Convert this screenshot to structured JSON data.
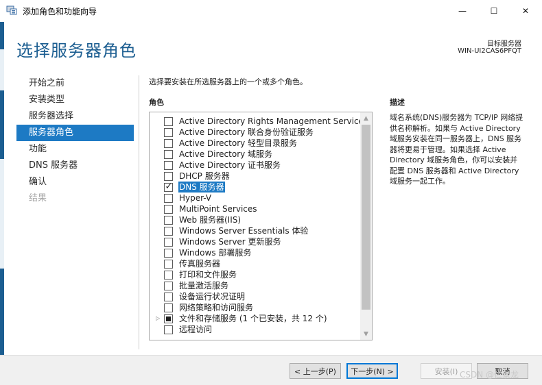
{
  "window": {
    "title": "添加角色和功能向导",
    "minimize_symbol": "—",
    "maximize_symbol": "☐",
    "close_symbol": "✕"
  },
  "header": {
    "page_title": "选择服务器角色",
    "target_label": "目标服务器",
    "target_name": "WIN-UI2CAS6PFQT"
  },
  "nav": {
    "items": [
      {
        "label": "开始之前",
        "state": "normal"
      },
      {
        "label": "安装类型",
        "state": "normal"
      },
      {
        "label": "服务器选择",
        "state": "normal"
      },
      {
        "label": "服务器角色",
        "state": "active"
      },
      {
        "label": "功能",
        "state": "normal"
      },
      {
        "label": "DNS 服务器",
        "state": "normal"
      },
      {
        "label": "确认",
        "state": "normal"
      },
      {
        "label": "结果",
        "state": "disabled"
      }
    ]
  },
  "main": {
    "instruction": "选择要安装在所选服务器上的一个或多个角色。",
    "roles_heading": "角色",
    "roles": [
      {
        "label": "Active Directory Rights Management Services",
        "state": "unchecked"
      },
      {
        "label": "Active Directory 联合身份验证服务",
        "state": "unchecked"
      },
      {
        "label": "Active Directory 轻型目录服务",
        "state": "unchecked"
      },
      {
        "label": "Active Directory 域服务",
        "state": "unchecked"
      },
      {
        "label": "Active Directory 证书服务",
        "state": "unchecked"
      },
      {
        "label": "DHCP 服务器",
        "state": "unchecked"
      },
      {
        "label": "DNS 服务器",
        "state": "checked",
        "selected": true
      },
      {
        "label": "Hyper-V",
        "state": "unchecked"
      },
      {
        "label": "MultiPoint Services",
        "state": "unchecked"
      },
      {
        "label": "Web 服务器(IIS)",
        "state": "unchecked"
      },
      {
        "label": "Windows Server Essentials 体验",
        "state": "unchecked"
      },
      {
        "label": "Windows Server 更新服务",
        "state": "unchecked"
      },
      {
        "label": "Windows 部署服务",
        "state": "unchecked"
      },
      {
        "label": "传真服务器",
        "state": "unchecked"
      },
      {
        "label": "打印和文件服务",
        "state": "unchecked"
      },
      {
        "label": "批量激活服务",
        "state": "unchecked"
      },
      {
        "label": "设备运行状况证明",
        "state": "unchecked"
      },
      {
        "label": "网络策略和访问服务",
        "state": "unchecked"
      },
      {
        "label": "文件和存储服务 (1 个已安装，共 12 个)",
        "state": "partial",
        "expandable": true
      },
      {
        "label": "远程访问",
        "state": "unchecked"
      }
    ]
  },
  "description": {
    "heading": "描述",
    "text": "域名系统(DNS)服务器为 TCP/IP 网络提供名称解析。如果与 Active Directory 域服务安装在同一服务器上，DNS 服务器将更易于管理。如果选择 Active Directory 域服务角色，你可以安装并配置 DNS 服务器和 Active Directory 域服务一起工作。"
  },
  "footer": {
    "prev_label": "< 上一步(P)",
    "next_label": "下一步(N) >",
    "install_label": "安装(I)",
    "cancel_label": "取消"
  },
  "watermark": "CSDN @仁景龙",
  "colors": {
    "accent": "#1d7ac4",
    "title_blue": "#1c5e91"
  }
}
